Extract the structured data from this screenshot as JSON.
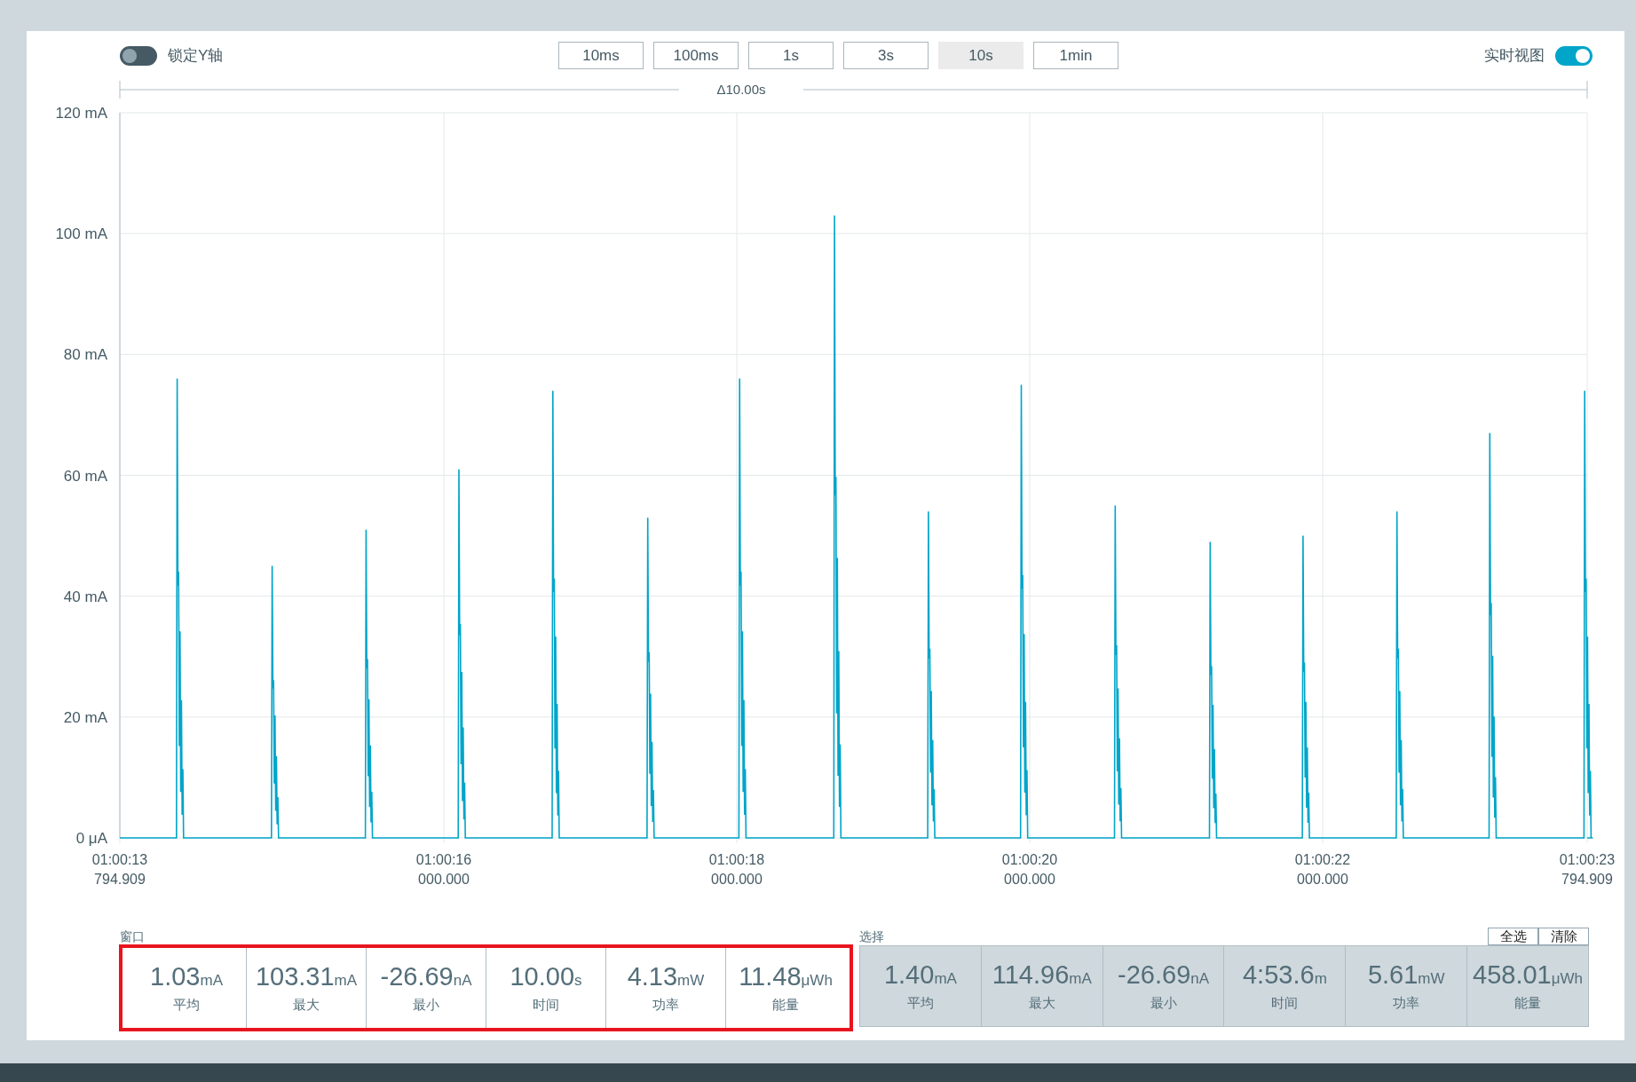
{
  "lock_y_axis": {
    "label": "锁定Y轴",
    "on": false
  },
  "timespan_buttons": [
    {
      "label": "10ms",
      "selected": false
    },
    {
      "label": "100ms",
      "selected": false
    },
    {
      "label": "1s",
      "selected": false
    },
    {
      "label": "3s",
      "selected": false
    },
    {
      "label": "10s",
      "selected": true
    },
    {
      "label": "1min",
      "selected": false
    }
  ],
  "live_view": {
    "label": "实时视图",
    "on": true
  },
  "range_label": "Δ10.00s",
  "chart": {
    "y_ticks": [
      "120 mA",
      "100 mA",
      "80 mA",
      "60 mA",
      "40 mA",
      "20 mA",
      "0 μA"
    ],
    "x_ticks": [
      {
        "time": "01:00:13",
        "fraction": "794.909"
      },
      {
        "time": "01:00:16",
        "fraction": "000.000"
      },
      {
        "time": "01:00:18",
        "fraction": "000.000"
      },
      {
        "time": "01:00:20",
        "fraction": "000.000"
      },
      {
        "time": "01:00:22",
        "fraction": "000.000"
      },
      {
        "time": "01:00:23",
        "fraction": "794.909"
      }
    ]
  },
  "window_stats": {
    "title": "窗口",
    "highlighted": true,
    "items": [
      {
        "value": "1.03",
        "unit": "mA",
        "label": "平均"
      },
      {
        "value": "103.31",
        "unit": "mA",
        "label": "最大"
      },
      {
        "value": "-26.69",
        "unit": "nA",
        "label": "最小"
      },
      {
        "value": "10.00",
        "unit": "s",
        "label": "时间"
      },
      {
        "value": "4.13",
        "unit": "mW",
        "label": "功率"
      },
      {
        "value": "11.48",
        "unit": "μWh",
        "label": "能量"
      }
    ]
  },
  "selection_stats": {
    "title": "选择",
    "buttons": [
      "全选",
      "清除"
    ],
    "items": [
      {
        "value": "1.40",
        "unit": "mA",
        "label": "平均"
      },
      {
        "value": "114.96",
        "unit": "mA",
        "label": "最大"
      },
      {
        "value": "-26.69",
        "unit": "nA",
        "label": "最小"
      },
      {
        "value": "4:53.6",
        "unit": "m",
        "label": "时间"
      },
      {
        "value": "5.61",
        "unit": "mW",
        "label": "功率"
      },
      {
        "value": "458.01",
        "unit": "μWh",
        "label": "能量"
      }
    ]
  }
}
